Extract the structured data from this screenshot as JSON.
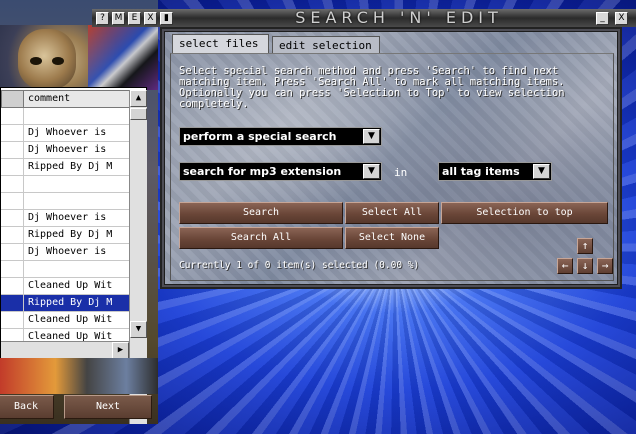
{
  "window": {
    "title": "SEARCH 'N' EDIT",
    "left_buttons": [
      "?",
      "M",
      "E",
      "X",
      "▮"
    ],
    "right_buttons": [
      "_",
      "X"
    ]
  },
  "tabs": [
    {
      "label": "select files",
      "active": true
    },
    {
      "label": "edit selection",
      "active": false
    }
  ],
  "description": "Select special search method and press 'Search' to find next matching item. Press 'Search All' to mark all matching items. Optionally you can press 'Selection to Top' to view selection completely.",
  "search_method": {
    "selected": "perform a special search"
  },
  "search_type": {
    "selected": "search for mp3 extension"
  },
  "in_label": "in",
  "search_scope": {
    "selected": "all tag items"
  },
  "buttons": {
    "search": "Search",
    "search_all": "Search All",
    "select_all": "Select All",
    "select_none": "Select None",
    "selection_to_top": "Selection to top"
  },
  "status": "Currently 1 of 0 item(s) selected (0.00 %)",
  "arrows": {
    "up": "↑",
    "left": "←",
    "down": "↓",
    "right": "→"
  },
  "file_list": {
    "column_header": "comment",
    "rows": [
      {
        "comment": "",
        "selected": false
      },
      {
        "comment": "Dj Whoever is",
        "selected": false
      },
      {
        "comment": "Dj Whoever is",
        "selected": false
      },
      {
        "comment": "Ripped By Dj M",
        "selected": false
      },
      {
        "comment": "",
        "selected": false
      },
      {
        "comment": "",
        "selected": false
      },
      {
        "comment": "Dj Whoever is",
        "selected": false
      },
      {
        "comment": "Ripped By Dj M",
        "selected": false
      },
      {
        "comment": "Dj Whoever is",
        "selected": false
      },
      {
        "comment": "",
        "selected": false
      },
      {
        "comment": "Cleaned Up Wit",
        "selected": false
      },
      {
        "comment": "Ripped By Dj M",
        "selected": true
      },
      {
        "comment": "Cleaned Up Wit",
        "selected": false
      },
      {
        "comment": "Cleaned Up Wit",
        "selected": false
      }
    ],
    "scroll_up": "▲",
    "scroll_down": "▼",
    "scroll_right": "▶"
  },
  "wizard": {
    "back": "Back",
    "next": "Next"
  }
}
